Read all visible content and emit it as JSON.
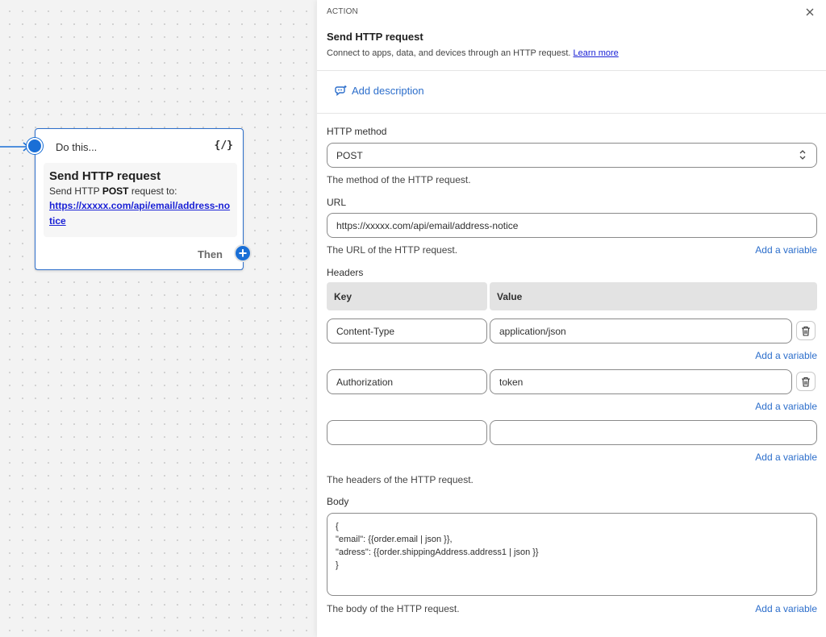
{
  "node": {
    "header": "Do this...",
    "code_icon": "{/}",
    "title": "Send HTTP request",
    "desc_prefix": "Send HTTP ",
    "desc_method": "POST",
    "desc_suffix": " request to:",
    "url": "https://xxxxx.com/api/email/address-notice",
    "then_label": "Then"
  },
  "panel": {
    "label": "ACTION",
    "title": "Send HTTP request",
    "subtitle": "Connect to apps, data, and devices through an HTTP request.",
    "learn_more": "Learn more",
    "add_description": "Add description",
    "method_label": "HTTP method",
    "method_value": "POST",
    "method_help": "The method of the HTTP request.",
    "url_label": "URL",
    "url_value": "https://xxxxx.com/api/email/address-notice",
    "url_help": "The URL of the HTTP request.",
    "add_variable": "Add a variable",
    "headers_label": "Headers",
    "headers_col_key": "Key",
    "headers_col_value": "Value",
    "headers": [
      {
        "key": "Content-Type",
        "value": "application/json"
      },
      {
        "key": "Authorization",
        "value": "token"
      },
      {
        "key": "",
        "value": ""
      }
    ],
    "headers_help": "The headers of the HTTP request.",
    "body_label": "Body",
    "body_value": "{\n\"email\": {{order.email | json }},\n\"adress\": {{order.shippingAddress.address1 | json }}\n}",
    "body_help": "The body of the HTTP request."
  },
  "icons": {
    "close": "close-icon",
    "trash": "trash-icon",
    "add": "plus-icon",
    "description": "chat-sparkle-icon",
    "select": "chevron-up-down-icon"
  },
  "colors": {
    "accent": "#2c6ecb",
    "link": "#1b22d6",
    "node_border": "#2c6ecb"
  }
}
